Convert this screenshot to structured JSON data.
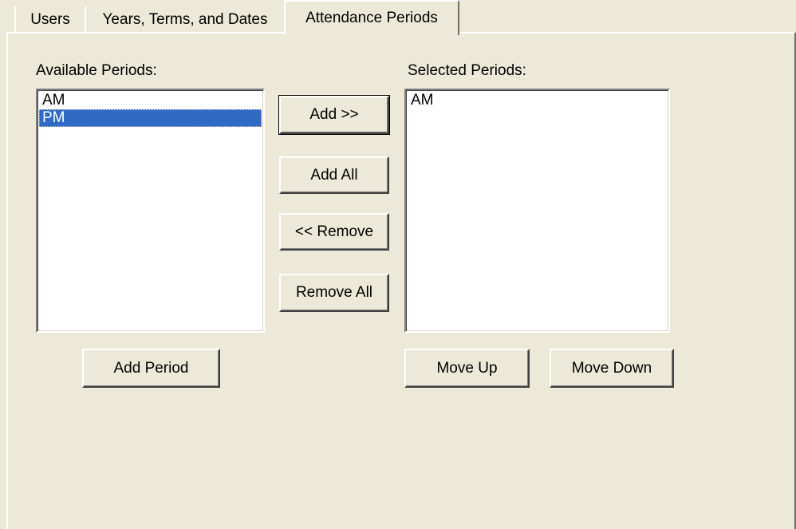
{
  "tabs": [
    {
      "label": "Users"
    },
    {
      "label": "Years, Terms, and Dates"
    },
    {
      "label": "Attendance Periods",
      "active": true
    }
  ],
  "available": {
    "label": "Available Periods:",
    "items": [
      "AM",
      "PM"
    ],
    "selected_item": "PM"
  },
  "selected": {
    "label": "Selected Periods:",
    "items": [
      "AM"
    ]
  },
  "buttons": {
    "add": "Add >>",
    "add_all": "Add All",
    "remove": "<< Remove",
    "remove_all": "Remove All",
    "add_period": "Add Period",
    "move_up": "Move Up",
    "move_down": "Move Down"
  },
  "colors": {
    "background": "#ece9d8",
    "selection": "#316ac5"
  }
}
